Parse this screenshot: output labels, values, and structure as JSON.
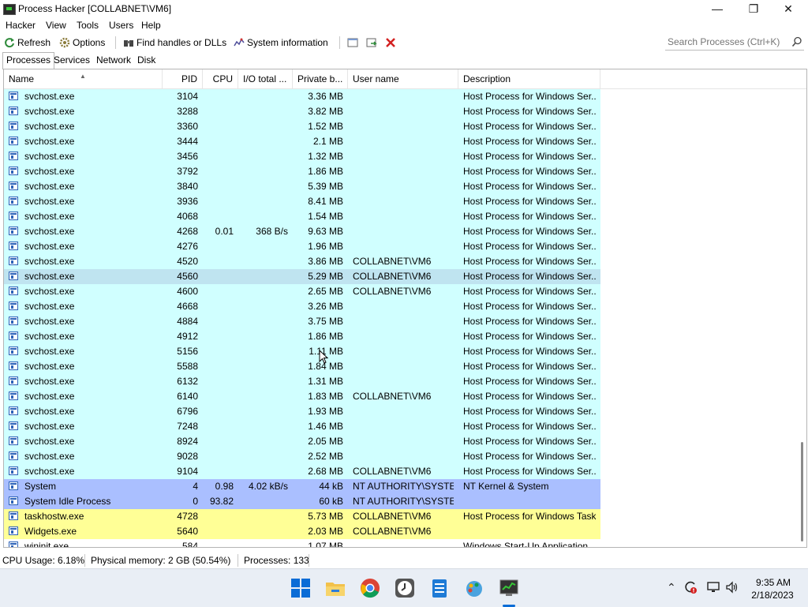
{
  "window": {
    "title": "Process Hacker [COLLABNET\\VM6]"
  },
  "menu": [
    "Hacker",
    "View",
    "Tools",
    "Users",
    "Help"
  ],
  "toolbar": {
    "refresh": "Refresh",
    "options": "Options",
    "find_handles": "Find handles or DLLs",
    "system_info": "System information",
    "search_placeholder": "Search Processes (Ctrl+K)"
  },
  "tabs": [
    "Processes",
    "Services",
    "Network",
    "Disk"
  ],
  "columns": {
    "name": "Name",
    "pid": "PID",
    "cpu": "CPU",
    "io": "I/O total ...",
    "private": "Private b...",
    "user": "User name",
    "desc": "Description"
  },
  "colors": {
    "service": "#d0ffff",
    "selected": "#bfe4f0",
    "system": "#aabfff",
    "own": "#ffff96"
  },
  "rows": [
    {
      "name": "svchost.exe",
      "pid": "3104",
      "cpu": "",
      "io": "",
      "private": "3.36 MB",
      "user": "",
      "desc": "Host Process for Windows Ser...",
      "kind": "service"
    },
    {
      "name": "svchost.exe",
      "pid": "3288",
      "cpu": "",
      "io": "",
      "private": "3.82 MB",
      "user": "",
      "desc": "Host Process for Windows Ser...",
      "kind": "service"
    },
    {
      "name": "svchost.exe",
      "pid": "3360",
      "cpu": "",
      "io": "",
      "private": "1.52 MB",
      "user": "",
      "desc": "Host Process for Windows Ser...",
      "kind": "service"
    },
    {
      "name": "svchost.exe",
      "pid": "3444",
      "cpu": "",
      "io": "",
      "private": "2.1 MB",
      "user": "",
      "desc": "Host Process for Windows Ser...",
      "kind": "service"
    },
    {
      "name": "svchost.exe",
      "pid": "3456",
      "cpu": "",
      "io": "",
      "private": "1.32 MB",
      "user": "",
      "desc": "Host Process for Windows Ser...",
      "kind": "service"
    },
    {
      "name": "svchost.exe",
      "pid": "3792",
      "cpu": "",
      "io": "",
      "private": "1.86 MB",
      "user": "",
      "desc": "Host Process for Windows Ser...",
      "kind": "service"
    },
    {
      "name": "svchost.exe",
      "pid": "3840",
      "cpu": "",
      "io": "",
      "private": "5.39 MB",
      "user": "",
      "desc": "Host Process for Windows Ser...",
      "kind": "service"
    },
    {
      "name": "svchost.exe",
      "pid": "3936",
      "cpu": "",
      "io": "",
      "private": "8.41 MB",
      "user": "",
      "desc": "Host Process for Windows Ser...",
      "kind": "service"
    },
    {
      "name": "svchost.exe",
      "pid": "4068",
      "cpu": "",
      "io": "",
      "private": "1.54 MB",
      "user": "",
      "desc": "Host Process for Windows Ser...",
      "kind": "service"
    },
    {
      "name": "svchost.exe",
      "pid": "4268",
      "cpu": "0.01",
      "io": "368 B/s",
      "private": "9.63 MB",
      "user": "",
      "desc": "Host Process for Windows Ser...",
      "kind": "service"
    },
    {
      "name": "svchost.exe",
      "pid": "4276",
      "cpu": "",
      "io": "",
      "private": "1.96 MB",
      "user": "",
      "desc": "Host Process for Windows Ser...",
      "kind": "service"
    },
    {
      "name": "svchost.exe",
      "pid": "4520",
      "cpu": "",
      "io": "",
      "private": "3.86 MB",
      "user": "COLLABNET\\VM6",
      "desc": "Host Process for Windows Ser...",
      "kind": "service"
    },
    {
      "name": "svchost.exe",
      "pid": "4560",
      "cpu": "",
      "io": "",
      "private": "5.29 MB",
      "user": "COLLABNET\\VM6",
      "desc": "Host Process for Windows Ser...",
      "kind": "selected"
    },
    {
      "name": "svchost.exe",
      "pid": "4600",
      "cpu": "",
      "io": "",
      "private": "2.65 MB",
      "user": "COLLABNET\\VM6",
      "desc": "Host Process for Windows Ser...",
      "kind": "service"
    },
    {
      "name": "svchost.exe",
      "pid": "4668",
      "cpu": "",
      "io": "",
      "private": "3.26 MB",
      "user": "",
      "desc": "Host Process for Windows Ser...",
      "kind": "service"
    },
    {
      "name": "svchost.exe",
      "pid": "4884",
      "cpu": "",
      "io": "",
      "private": "3.75 MB",
      "user": "",
      "desc": "Host Process for Windows Ser...",
      "kind": "service"
    },
    {
      "name": "svchost.exe",
      "pid": "4912",
      "cpu": "",
      "io": "",
      "private": "1.86 MB",
      "user": "",
      "desc": "Host Process for Windows Ser...",
      "kind": "service"
    },
    {
      "name": "svchost.exe",
      "pid": "5156",
      "cpu": "",
      "io": "",
      "private": "1.11 MB",
      "user": "",
      "desc": "Host Process for Windows Ser...",
      "kind": "service"
    },
    {
      "name": "svchost.exe",
      "pid": "5588",
      "cpu": "",
      "io": "",
      "private": "1.84 MB",
      "user": "",
      "desc": "Host Process for Windows Ser...",
      "kind": "service"
    },
    {
      "name": "svchost.exe",
      "pid": "6132",
      "cpu": "",
      "io": "",
      "private": "1.31 MB",
      "user": "",
      "desc": "Host Process for Windows Ser...",
      "kind": "service"
    },
    {
      "name": "svchost.exe",
      "pid": "6140",
      "cpu": "",
      "io": "",
      "private": "1.83 MB",
      "user": "COLLABNET\\VM6",
      "desc": "Host Process for Windows Ser...",
      "kind": "service"
    },
    {
      "name": "svchost.exe",
      "pid": "6796",
      "cpu": "",
      "io": "",
      "private": "1.93 MB",
      "user": "",
      "desc": "Host Process for Windows Ser...",
      "kind": "service"
    },
    {
      "name": "svchost.exe",
      "pid": "7248",
      "cpu": "",
      "io": "",
      "private": "1.46 MB",
      "user": "",
      "desc": "Host Process for Windows Ser...",
      "kind": "service"
    },
    {
      "name": "svchost.exe",
      "pid": "8924",
      "cpu": "",
      "io": "",
      "private": "2.05 MB",
      "user": "",
      "desc": "Host Process for Windows Ser...",
      "kind": "service"
    },
    {
      "name": "svchost.exe",
      "pid": "9028",
      "cpu": "",
      "io": "",
      "private": "2.52 MB",
      "user": "",
      "desc": "Host Process for Windows Ser...",
      "kind": "service"
    },
    {
      "name": "svchost.exe",
      "pid": "9104",
      "cpu": "",
      "io": "",
      "private": "2.68 MB",
      "user": "COLLABNET\\VM6",
      "desc": "Host Process for Windows Ser...",
      "kind": "service"
    },
    {
      "name": "System",
      "pid": "4",
      "cpu": "0.98",
      "io": "4.02 kB/s",
      "private": "44 kB",
      "user": "NT AUTHORITY\\SYSTEM",
      "desc": "NT Kernel & System",
      "kind": "system"
    },
    {
      "name": "System Idle Process",
      "pid": "0",
      "cpu": "93.82",
      "io": "",
      "private": "60 kB",
      "user": "NT AUTHORITY\\SYSTEM",
      "desc": "",
      "kind": "system"
    },
    {
      "name": "taskhostw.exe",
      "pid": "4728",
      "cpu": "",
      "io": "",
      "private": "5.73 MB",
      "user": "COLLABNET\\VM6",
      "desc": "Host Process for Windows Tasks",
      "kind": "own"
    },
    {
      "name": "Widgets.exe",
      "pid": "5640",
      "cpu": "",
      "io": "",
      "private": "2.03 MB",
      "user": "COLLABNET\\VM6",
      "desc": "",
      "kind": "own"
    },
    {
      "name": "wininit.exe",
      "pid": "584",
      "cpu": "",
      "io": "",
      "private": "1.07 MB",
      "user": "",
      "desc": "Windows Start-Up Application",
      "kind": "plain"
    }
  ],
  "status": {
    "cpu": "CPU Usage: 6.18%",
    "memory": "Physical memory: 2 GB (50.54%)",
    "processes": "Processes: 133"
  },
  "clock": {
    "time": "9:35 AM",
    "date": "2/18/2023"
  }
}
